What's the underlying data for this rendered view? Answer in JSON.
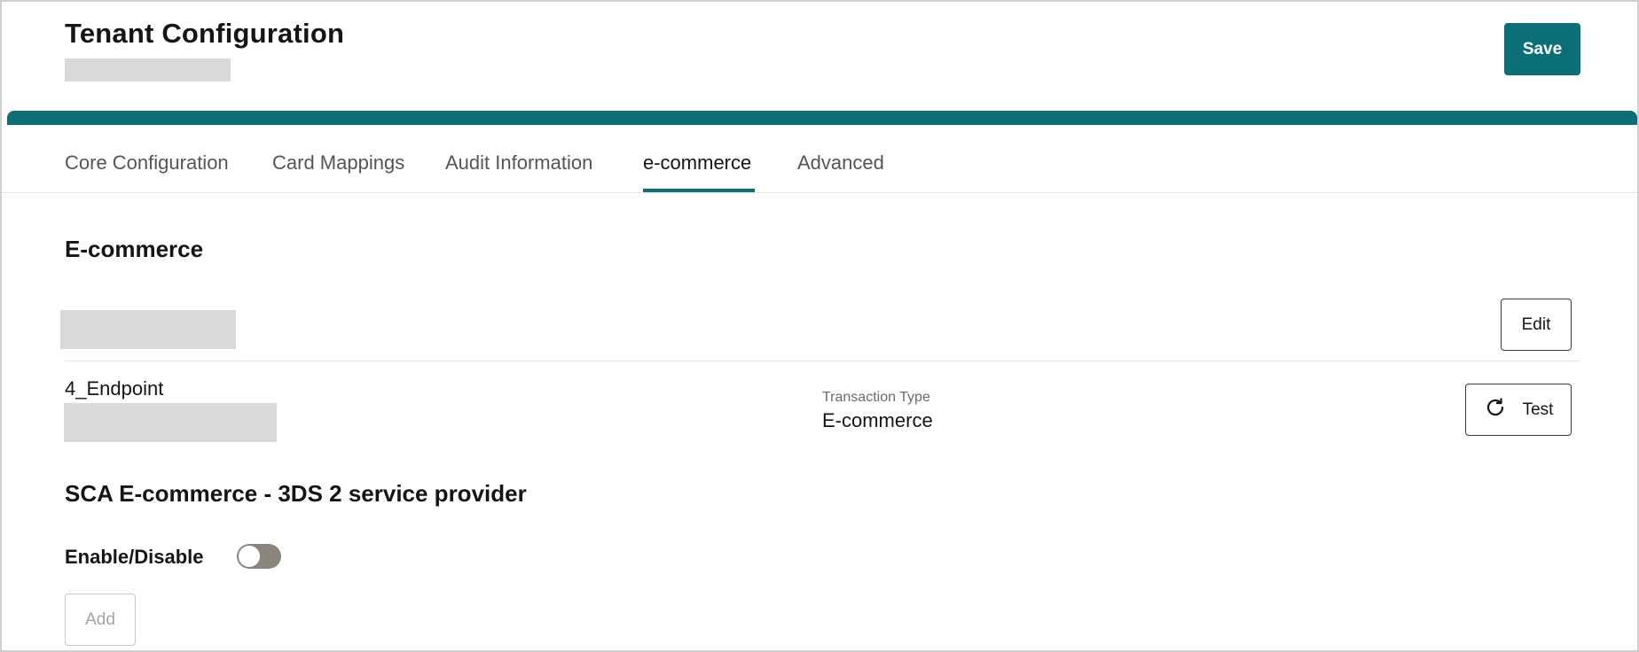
{
  "header": {
    "title": "Tenant Configuration",
    "save_label": "Save"
  },
  "tabs": [
    {
      "label": "Core Configuration"
    },
    {
      "label": "Card Mappings"
    },
    {
      "label": "Audit Information"
    },
    {
      "label": "e-commerce",
      "active": true
    },
    {
      "label": "Advanced"
    }
  ],
  "ecommerce": {
    "section_title": "E-commerce",
    "edit_label": "Edit",
    "endpoint": {
      "name": "4_Endpoint",
      "transaction_type_label": "Transaction Type",
      "transaction_type_value": "E-commerce",
      "test_label": "Test"
    }
  },
  "sca": {
    "section_title": "SCA E-commerce - 3DS 2 service provider",
    "enable_label": "Enable/Disable",
    "enabled": false,
    "add_label": "Add"
  },
  "colors": {
    "accent": "#0c6e76",
    "toggle_off": "#8c857d",
    "placeholder": "#d9d9d9"
  },
  "icons": {
    "test": "refresh-icon"
  }
}
